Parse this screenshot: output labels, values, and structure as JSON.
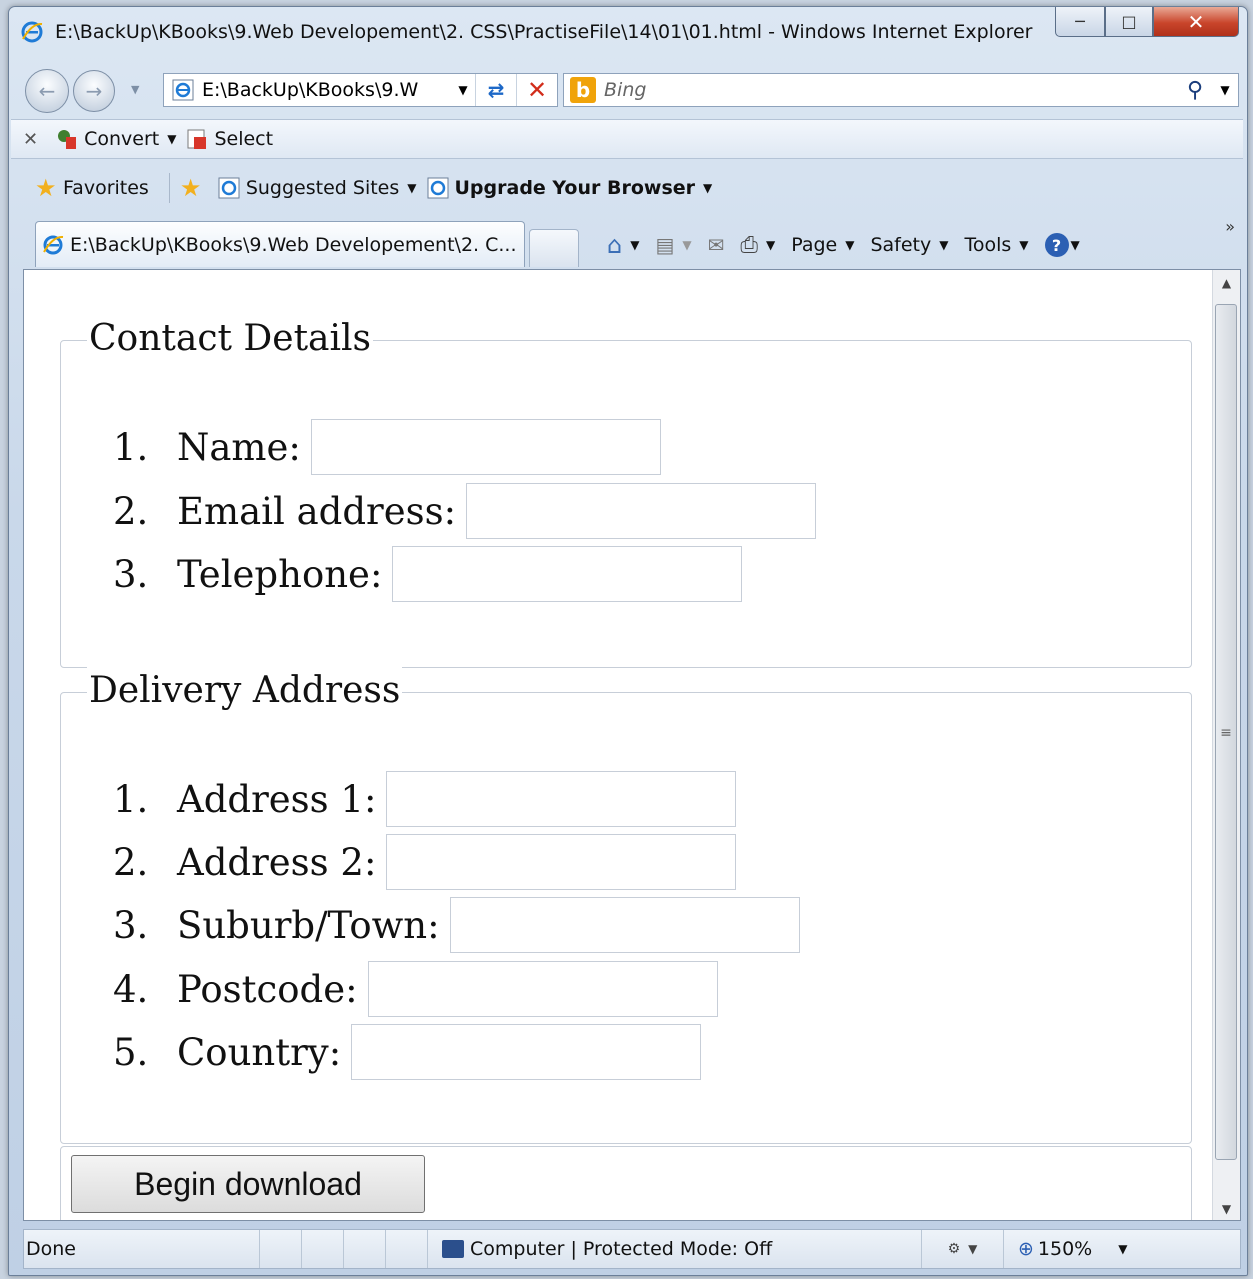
{
  "window": {
    "title": "E:\\BackUp\\KBooks\\9.Web Developement\\2. CSS\\PractiseFile\\14\\01\\01.html - Windows Internet Explorer"
  },
  "address_bar": {
    "value": "E:\\BackUp\\KBooks\\9.W"
  },
  "search": {
    "placeholder": "Bing"
  },
  "convert_toolbar": {
    "convert_label": "Convert",
    "select_label": "Select"
  },
  "favorites_bar": {
    "favorites_label": "Favorites",
    "suggested_label": "Suggested Sites",
    "upgrade_label": "Upgrade Your Browser"
  },
  "tab": {
    "label": "E:\\BackUp\\KBooks\\9.Web Developement\\2. C..."
  },
  "command_bar": {
    "page_label": "Page",
    "safety_label": "Safety",
    "tools_label": "Tools"
  },
  "form": {
    "contact": {
      "legend": "Contact Details",
      "fields": [
        {
          "num": "1.",
          "label": "Name:"
        },
        {
          "num": "2.",
          "label": "Email address:"
        },
        {
          "num": "3.",
          "label": "Telephone:"
        }
      ]
    },
    "delivery": {
      "legend": "Delivery Address",
      "fields": [
        {
          "num": "1.",
          "label": "Address 1:"
        },
        {
          "num": "2.",
          "label": "Address 2:"
        },
        {
          "num": "3.",
          "label": "Suburb/Town:"
        },
        {
          "num": "4.",
          "label": "Postcode:"
        },
        {
          "num": "5.",
          "label": "Country:"
        }
      ]
    },
    "submit_label": "Begin download"
  },
  "status_bar": {
    "status": "Done",
    "zone": "Computer | Protected Mode: Off",
    "zoom": "150%"
  },
  "colors": {
    "chrome": "#c9d8ea",
    "close_button": "#c9452b",
    "field_border": "#c7ced8"
  }
}
